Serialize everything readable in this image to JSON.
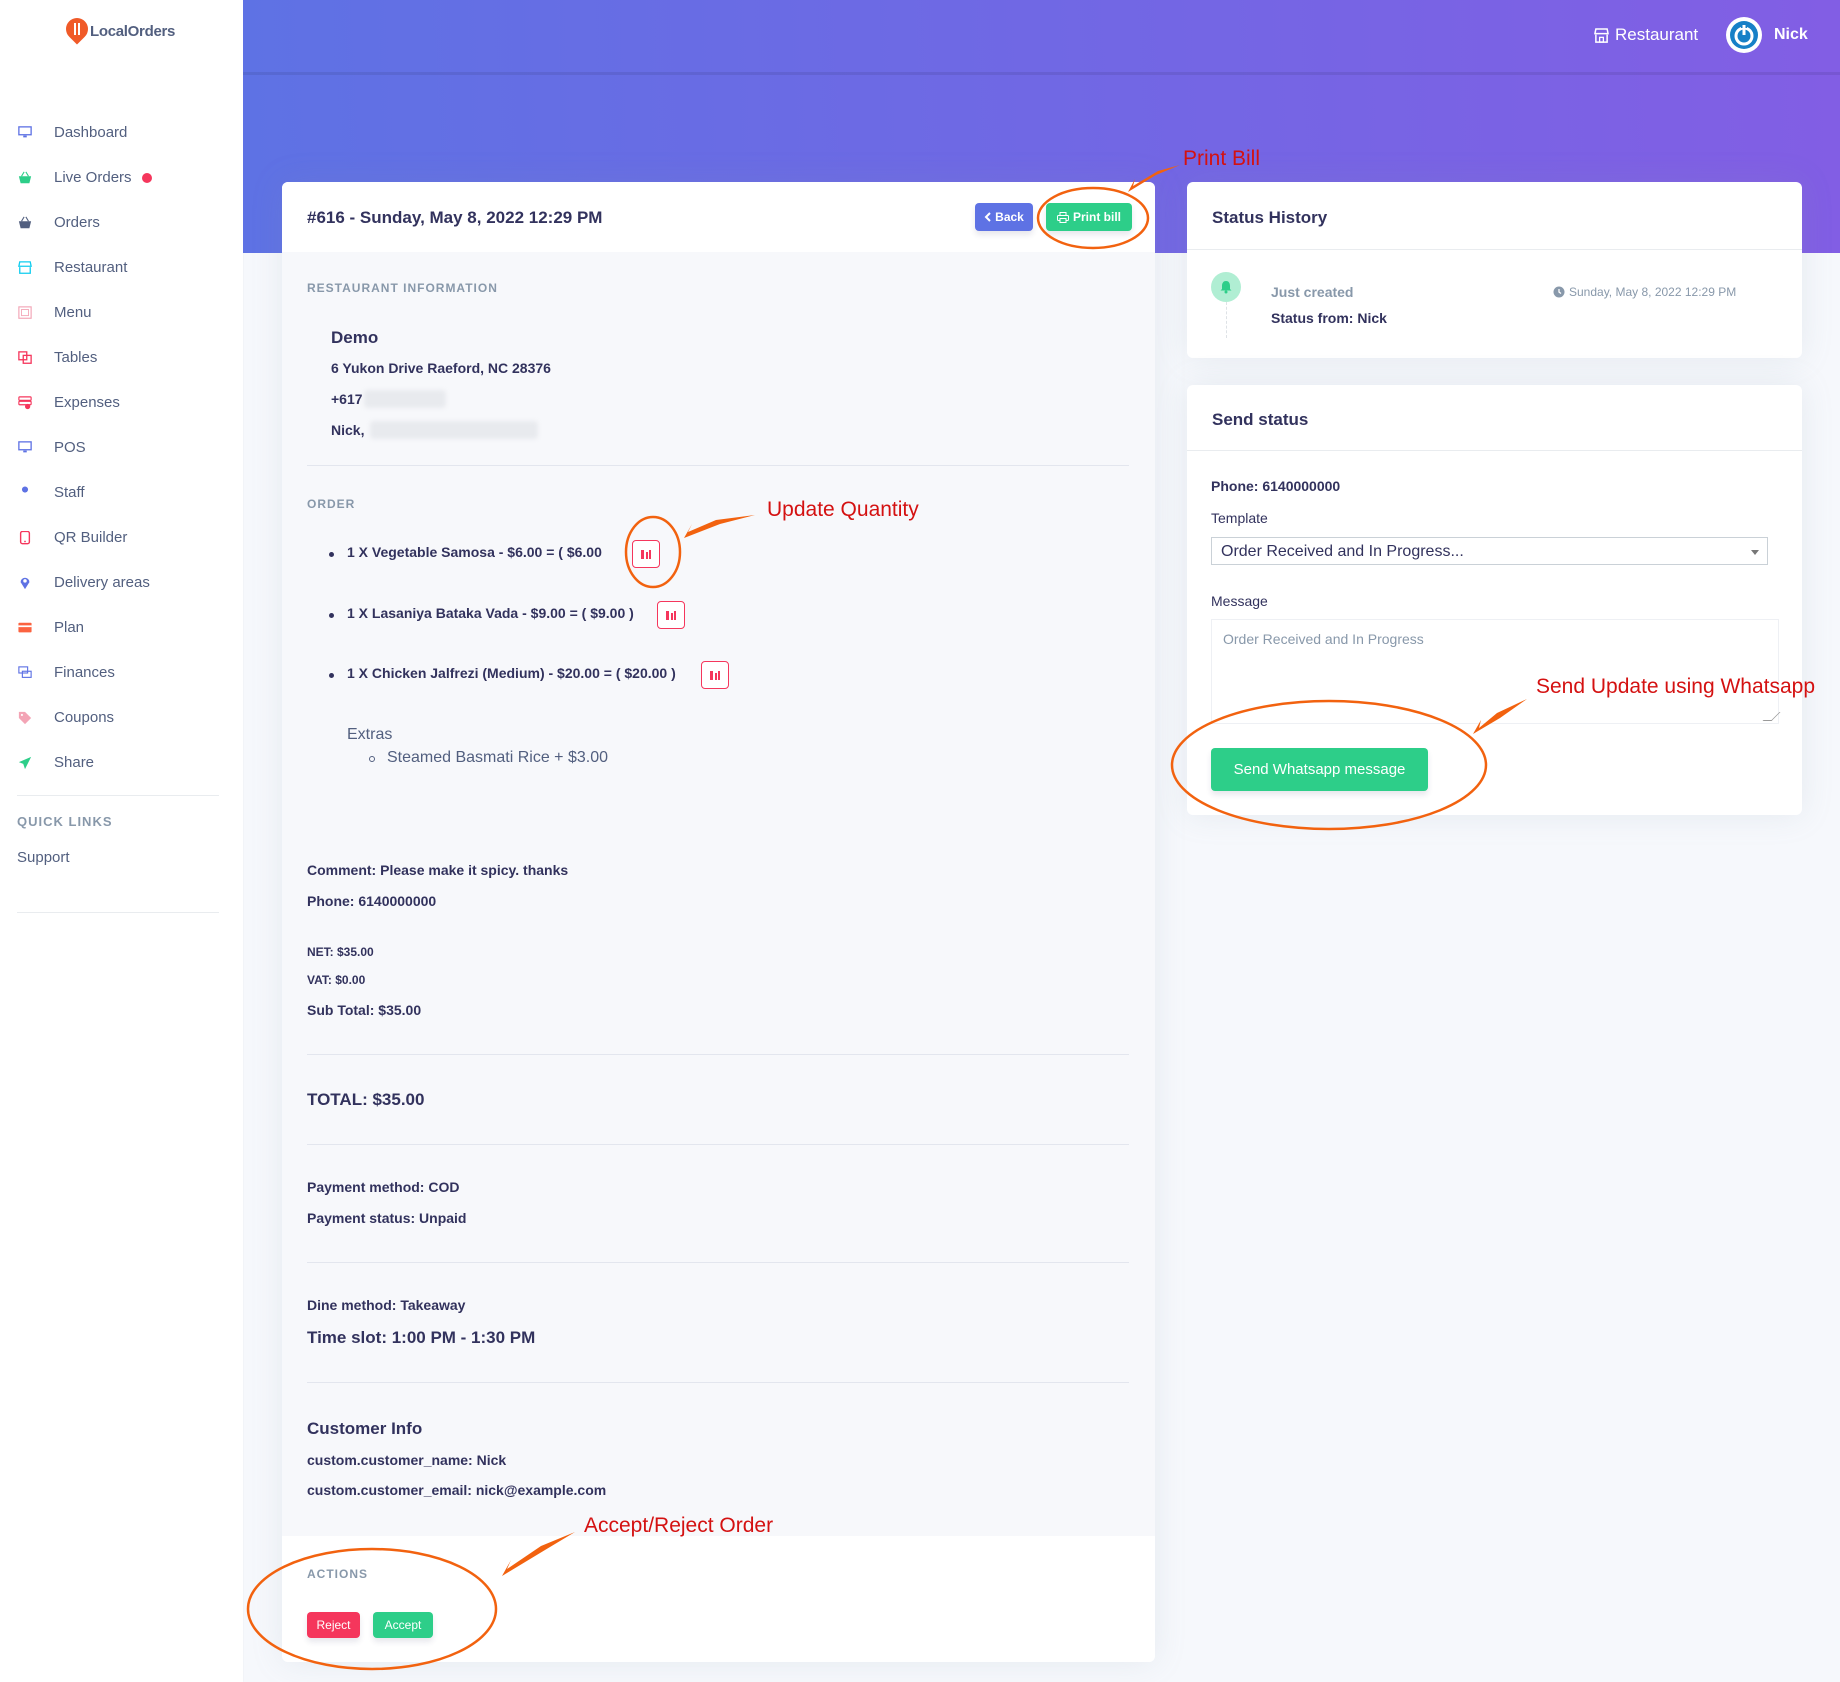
{
  "brand": {
    "name": "LocalOrders"
  },
  "sidebar": {
    "items": [
      {
        "label": "Dashboard",
        "icon": "monitor-icon",
        "color": "#5e72e4"
      },
      {
        "label": "Live Orders",
        "icon": "basket-icon",
        "color": "#2dce89"
      },
      {
        "label": "Orders",
        "icon": "basket-icon",
        "color": "#525f7f"
      },
      {
        "label": "Restaurant",
        "icon": "shop-icon",
        "color": "#11cdef"
      },
      {
        "label": "Menu",
        "icon": "menu-icon",
        "color": "#f3a4b5"
      },
      {
        "label": "Tables",
        "icon": "tables-icon",
        "color": "#f5365c"
      },
      {
        "label": "Expenses",
        "icon": "coins-icon",
        "color": "#f5365c"
      },
      {
        "label": "POS",
        "icon": "monitor-icon",
        "color": "#5e72e4"
      },
      {
        "label": "Staff",
        "icon": "user-icon",
        "color": "#5e72e4"
      },
      {
        "label": "QR Builder",
        "icon": "mobile-icon",
        "color": "#f5365c"
      },
      {
        "label": "Delivery areas",
        "icon": "pin-icon",
        "color": "#5e72e4"
      },
      {
        "label": "Plan",
        "icon": "card-icon",
        "color": "#fb6340"
      },
      {
        "label": "Finances",
        "icon": "money-icon",
        "color": "#5e72e4"
      },
      {
        "label": "Coupons",
        "icon": "tag-icon",
        "color": "#f3a4b5"
      },
      {
        "label": "Share",
        "icon": "send-icon",
        "color": "#2dce89"
      }
    ],
    "quick_links_title": "QUICK LINKS",
    "support_label": "Support"
  },
  "topbar": {
    "restaurant_label": "Restaurant",
    "user_name": "Nick"
  },
  "order": {
    "title": "#616 - Sunday, May 8, 2022 12:29 PM",
    "back_label": "Back",
    "print_label": "Print bill",
    "restaurant_info_label": "RESTAURANT INFORMATION",
    "restaurant_name": "Demo",
    "address": "6 Yukon Drive Raeford, NC 28376",
    "phone_prefix": "+617",
    "owner_prefix": "Nick,",
    "order_label": "ORDER",
    "items": [
      "1 X Vegetable Samosa - $6.00 = ( $6.00",
      "1 X Lasaniya Bataka Vada - $9.00 = ( $9.00 )",
      "1 X Chicken Jalfrezi (Medium) - $20.00 = ( $20.00 )"
    ],
    "extras_label": "Extras",
    "extras": [
      "Steamed Basmati Rice + $3.00"
    ],
    "comment": "Comment: Please make it spicy. thanks",
    "phone": "Phone: 6140000000",
    "net": "NET: $35.00",
    "vat": "VAT: $0.00",
    "subtotal": "Sub Total: $35.00",
    "total": "TOTAL: $35.00",
    "payment_method": "Payment method: COD",
    "payment_status": "Payment status: Unpaid",
    "dine_method": "Dine method: Takeaway",
    "time_slot": "Time slot: 1:00 PM - 1:30 PM",
    "customer_info_title": "Customer Info",
    "customer_name": "custom.customer_name: Nick",
    "customer_email": "custom.customer_email: nick@example.com",
    "actions_label": "ACTIONS",
    "reject_label": "Reject",
    "accept_label": "Accept"
  },
  "status_history": {
    "title": "Status History",
    "entry_status": "Just created",
    "entry_from": "Status from: Nick",
    "entry_time": "Sunday, May 8, 2022 12:29 PM"
  },
  "send_status": {
    "title": "Send status",
    "phone": "Phone: 6140000000",
    "template_label": "Template",
    "template_selected": "Order Received and In Progress...",
    "message_label": "Message",
    "message_value": "Order Received and In Progress",
    "send_button": "Send Whatsapp message"
  },
  "annotations": {
    "print_bill": "Print Bill",
    "update_quantity": "Update Quantity",
    "send_update": "Send Update using Whatsapp",
    "accept_reject": "Accept/Reject Order"
  },
  "colors": {
    "primary": "#5e72e4",
    "success": "#2dce89",
    "danger": "#f5365c",
    "annotation": "#f2620f",
    "annotation_text": "#d41111"
  }
}
